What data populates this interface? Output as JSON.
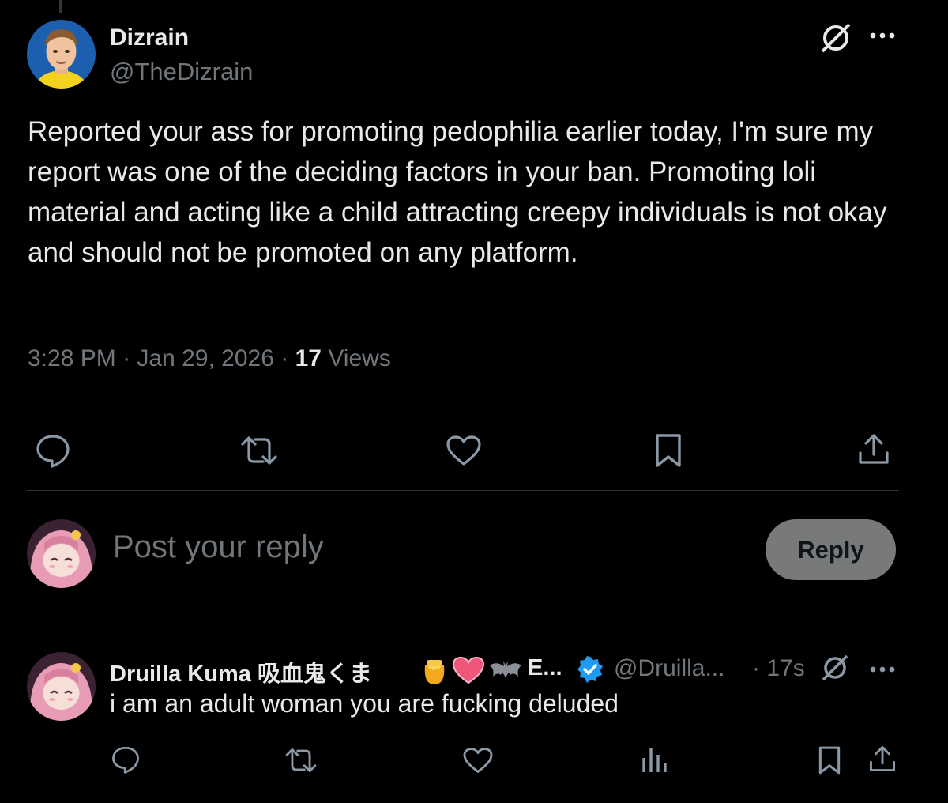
{
  "tweet": {
    "author_name": "Dizrain",
    "author_handle": "@TheDizrain",
    "text": "Reported your ass for promoting pedophilia earlier today, I'm sure my report was one of the deciding factors in your ban. Promoting loli material and acting like a child attracting creepy individuals is not okay and should not be promoted on any platform.",
    "time": "3:28 PM",
    "date": "Jan 29, 2026",
    "views_count": "17",
    "views_label": "Views",
    "separator": "·"
  },
  "composer": {
    "placeholder": "Post your reply",
    "reply_button": "Reply"
  },
  "reply": {
    "author_name": "Druilla Kuma 吸血鬼くま",
    "name_suffix": "E...",
    "author_handle": "@Druilla...",
    "time_ago": "· 17s",
    "text": "i am an adult woman you are fucking deluded"
  },
  "icons": {
    "grok": "grok-icon",
    "more": "more-icon",
    "reply": "reply-icon",
    "retweet": "retweet-icon",
    "like": "like-icon",
    "bookmark": "bookmark-icon",
    "share": "share-icon",
    "analytics": "analytics-icon",
    "verified": "verified-badge-icon"
  },
  "colors": {
    "background": "#000000",
    "text": "#e7e9ea",
    "muted": "#71767b",
    "divider": "#2f3336",
    "verified": "#1d9bf0",
    "reply_button_bg": "#787a7a"
  }
}
